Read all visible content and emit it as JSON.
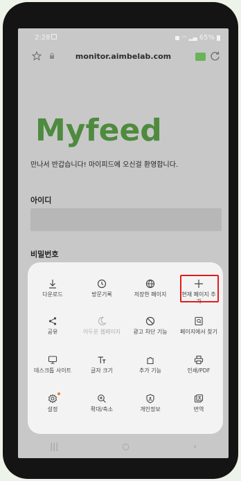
{
  "status_bar": {
    "time": "2:28",
    "battery": "65%"
  },
  "browser": {
    "url": "monitor.aimbelab.com"
  },
  "page": {
    "logo": "Myfeed",
    "welcome": "만나서 반갑습니다! 마이피드에 오신걸 환영합니다.",
    "id_label": "아이디",
    "password_label": "비밀번호"
  },
  "menu": {
    "items": [
      {
        "label": "다운로드",
        "icon": "download-icon"
      },
      {
        "label": "방문기록",
        "icon": "history-icon"
      },
      {
        "label": "저장한 페이지",
        "icon": "saved-pages-icon"
      },
      {
        "label": "현재 페이지 추가",
        "icon": "plus-icon"
      },
      {
        "label": "공유",
        "icon": "share-icon"
      },
      {
        "label": "어두운 웹페이지",
        "icon": "moon-icon"
      },
      {
        "label": "광고 차단 기능",
        "icon": "block-icon"
      },
      {
        "label": "페이지에서 찾기",
        "icon": "find-in-page-icon"
      },
      {
        "label": "데스크톱 사이트",
        "icon": "desktop-icon"
      },
      {
        "label": "글자 크기",
        "icon": "text-size-icon"
      },
      {
        "label": "추가 기능",
        "icon": "extensions-icon"
      },
      {
        "label": "인쇄/PDF",
        "icon": "print-icon"
      },
      {
        "label": "설정",
        "icon": "settings-icon"
      },
      {
        "label": "확대/축소",
        "icon": "zoom-icon"
      },
      {
        "label": "개인정보",
        "icon": "privacy-icon"
      },
      {
        "label": "번역",
        "icon": "translate-icon"
      }
    ],
    "highlight_color": "#e11c1c"
  },
  "colors": {
    "brand": "#4e8b3e",
    "accent_dot": "#f07a2a"
  }
}
